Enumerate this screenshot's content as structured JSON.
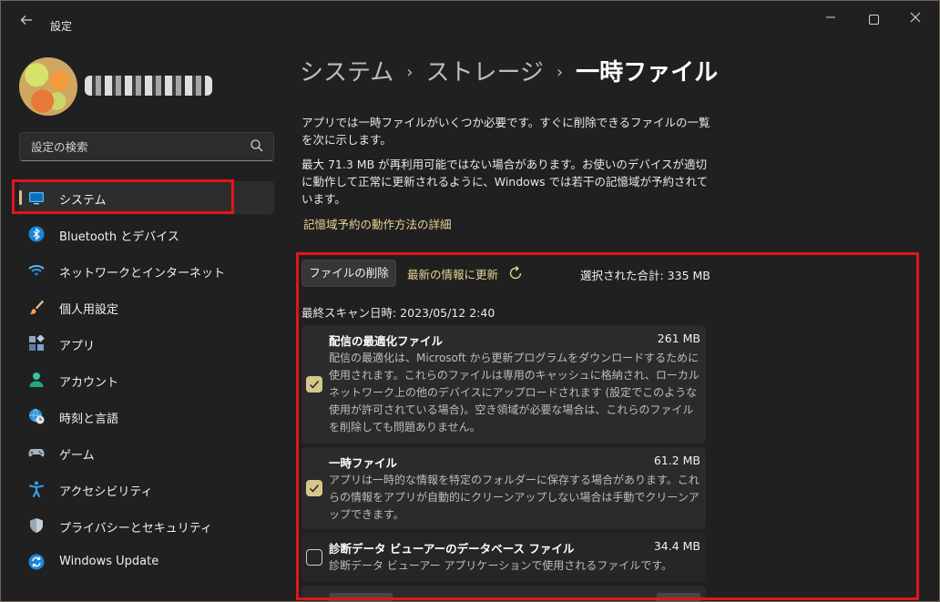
{
  "window": {
    "app_title": "設定"
  },
  "sidebar": {
    "search_placeholder": "設定の検索",
    "items": [
      {
        "label": "システム",
        "icon": "monitor-icon",
        "active": true
      },
      {
        "label": "Bluetooth とデバイス",
        "icon": "bluetooth-icon"
      },
      {
        "label": "ネットワークとインターネット",
        "icon": "wifi-icon"
      },
      {
        "label": "個人用設定",
        "icon": "brush-icon"
      },
      {
        "label": "アプリ",
        "icon": "apps-icon"
      },
      {
        "label": "アカウント",
        "icon": "person-icon"
      },
      {
        "label": "時刻と言語",
        "icon": "globe-clock-icon"
      },
      {
        "label": "ゲーム",
        "icon": "gamepad-icon"
      },
      {
        "label": "アクセシビリティ",
        "icon": "accessibility-icon"
      },
      {
        "label": "プライバシーとセキュリティ",
        "icon": "shield-icon"
      },
      {
        "label": "Windows Update",
        "icon": "sync-icon"
      }
    ]
  },
  "main": {
    "breadcrumb": [
      "システム",
      "ストレージ",
      "一時ファイル"
    ],
    "description1": "アプリでは一時ファイルがいくつか必要です。すぐに削除できるファイルの一覧を次に示します。",
    "description2": "最大 71.3 MB が再利用可能ではない場合があります。お使いのデバイスが適切に動作して正常に更新されるように、Windows では若干の記憶域が予約されています。",
    "learn_more": "記憶域予約の動作方法の詳細",
    "toolbar": {
      "delete_label": "ファイルの削除",
      "refresh_label": "最新の情報に更新",
      "total": "選択された合計: 335 MB"
    },
    "last_scan": "最終スキャン日時: 2023/05/12 2:40",
    "files": [
      {
        "title": "配信の最適化ファイル",
        "size": "261 MB",
        "checked": true,
        "desc": "配信の最適化は、Microsoft から更新プログラムをダウンロードするために使用されます。これらのファイルは専用のキャッシュに格納され、ローカル ネットワーク上の他のデバイスにアップロードされます (設定でこのような使用が許可されている場合)。空き領域が必要な場合は、これらのファイルを削除しても問題ありません。"
      },
      {
        "title": "一時ファイル",
        "size": "61.2 MB",
        "checked": true,
        "desc": "アプリは一時的な情報を特定のフォルダーに保存する場合があります。これらの情報をアプリが自動的にクリーンアップしない場合は手動でクリーンアップできます。"
      },
      {
        "title": "診断データ ビューアーのデータベース ファイル",
        "size": "34.4 MB",
        "checked": false,
        "desc": "診断データ ビューアー アプリケーションで使用されるファイルです。"
      }
    ]
  },
  "colors": {
    "accent": "#d6c68a",
    "highlight_box": "#e0161b",
    "link": "#e6d596"
  }
}
